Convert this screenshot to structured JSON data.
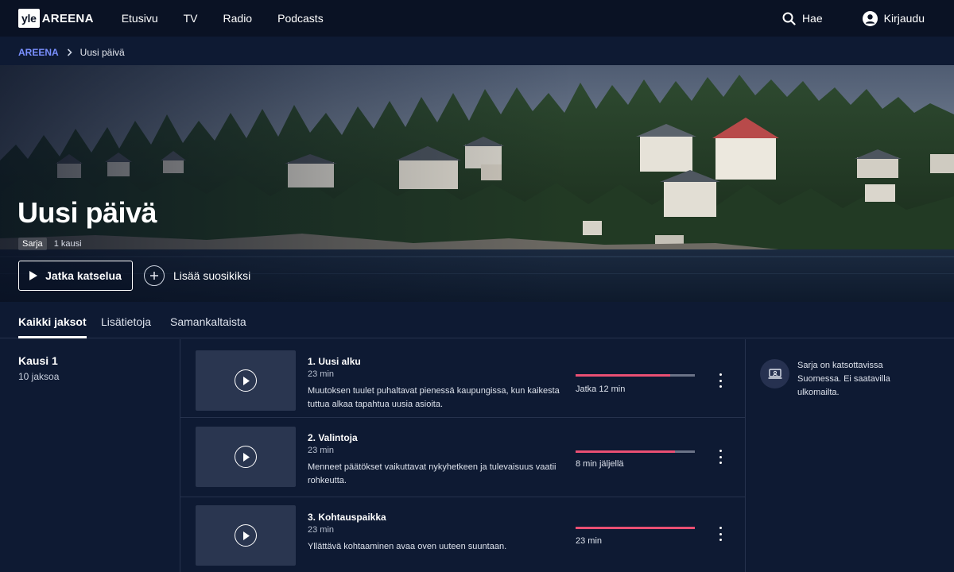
{
  "nav": {
    "logo_mark": "yle",
    "logo_text": "AREENA",
    "links": [
      "Etusivu",
      "TV",
      "Radio",
      "Podcasts"
    ],
    "search_label": "Hae",
    "login_label": "Kirjaudu"
  },
  "breadcrumb": {
    "root": "AREENA",
    "current": "Uusi päivä"
  },
  "hero": {
    "title": "Uusi päivä",
    "badge": "Sarja",
    "seasons": "1 kausi",
    "play_label": "Jatka katselua",
    "favorite_label": "Lisää suosikiksi"
  },
  "tabs": [
    "Kaikki jaksot",
    "Lisätietoja",
    "Samankaltaista"
  ],
  "season": {
    "title": "Kausi 1",
    "count": "10 jaksoa"
  },
  "episodes": [
    {
      "title": "1. Uusi alku",
      "duration": "23 min",
      "description": "Muutoksen tuulet puhaltavat pienessä kaupungissa, kun kaikesta tuttua alkaa tapahtua uusia asioita.",
      "progress": 0.79,
      "status": "Jatka 12 min"
    },
    {
      "title": "2. Valintoja",
      "duration": "23 min",
      "description": "Menneet päätökset vaikuttavat nykyhetkeen ja tulevaisuus vaatii rohkeutta.",
      "progress": 0.83,
      "status": "8 min jäljellä"
    },
    {
      "title": "3. Kohtauspaikka",
      "duration": "23 min",
      "description": "Yllättävä kohtaaminen avaa oven uuteen suuntaan.",
      "progress": 1.0,
      "status": "23 min"
    }
  ],
  "info": {
    "text": "Sarja on katsottavissa Suomessa. Ei saatavilla ulkomailta."
  },
  "colors": {
    "accent": "#7a90ff",
    "progress": "#ea4f73",
    "background": "#0e1a33"
  }
}
